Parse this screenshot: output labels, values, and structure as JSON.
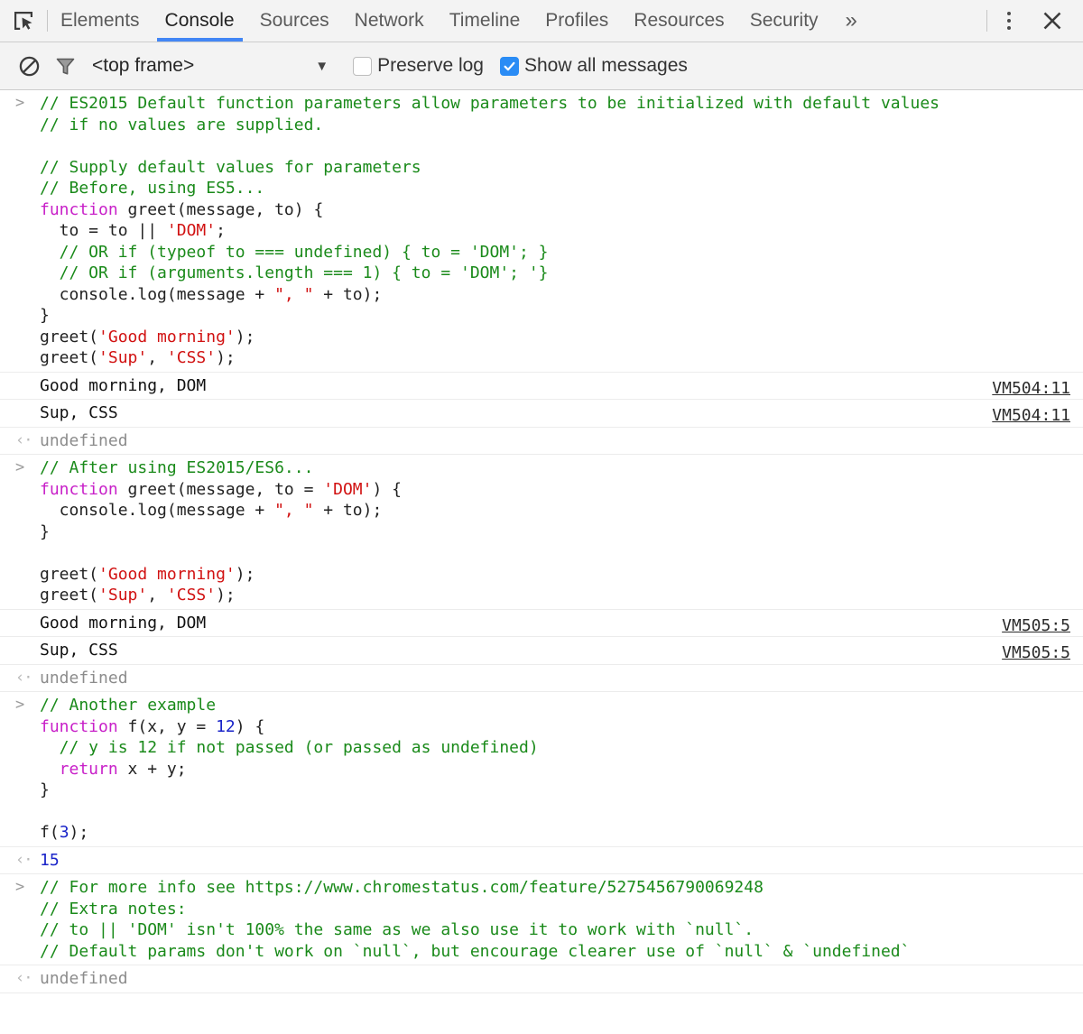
{
  "window": {
    "title": "Chrome DevTools — Console"
  },
  "tabbar": {
    "inspect_icon": "inspect-element-icon",
    "tabs": [
      {
        "label": "Elements",
        "active": false
      },
      {
        "label": "Console",
        "active": true
      },
      {
        "label": "Sources",
        "active": false
      },
      {
        "label": "Network",
        "active": false
      },
      {
        "label": "Timeline",
        "active": false
      },
      {
        "label": "Profiles",
        "active": false
      },
      {
        "label": "Resources",
        "active": false
      },
      {
        "label": "Security",
        "active": false
      }
    ],
    "overflow_label": "»",
    "menu_icon": "kebab-menu-icon",
    "close_label": "✕",
    "active_tab_accent": "#4286f5"
  },
  "toolbar": {
    "clear_icon": "clear-console-icon",
    "filter_icon": "filter-funnel-icon",
    "frame_value": "<top frame>",
    "frame_caret": "▼",
    "preserve_log": {
      "label": "Preserve log",
      "checked": false
    },
    "show_all_messages": {
      "label": "Show all messages",
      "checked": true,
      "accent": "#2a8cf5"
    }
  },
  "console": {
    "prompt_glyph": ">",
    "result_glyph": "‹·",
    "messages": [
      {
        "kind": "input",
        "tokens": [
          [
            [
              "com",
              "// ES2015 Default function parameters allow parameters to be initialized with default values"
            ]
          ],
          [
            [
              "com",
              "// if no values are supplied."
            ]
          ],
          [
            [
              "pln",
              ""
            ]
          ],
          [
            [
              "com",
              "// Supply default values for parameters"
            ]
          ],
          [
            [
              "com",
              "// Before, using ES5..."
            ]
          ],
          [
            [
              "kw",
              "function"
            ],
            [
              "pln",
              " greet(message, to) {"
            ]
          ],
          [
            [
              "pln",
              "  to = to || "
            ],
            [
              "str",
              "'DOM'"
            ],
            [
              "pln",
              ";"
            ]
          ],
          [
            [
              "com",
              "  // OR if (typeof to === undefined) { to = 'DOM'; }"
            ]
          ],
          [
            [
              "com",
              "  // OR if (arguments.length === 1) { to = 'DOM'; '}"
            ]
          ],
          [
            [
              "pln",
              "  console.log(message + "
            ],
            [
              "str",
              "\", \""
            ],
            [
              "pln",
              " + to);"
            ]
          ],
          [
            [
              "pln",
              "}"
            ]
          ],
          [
            [
              "pln",
              "greet("
            ],
            [
              "str",
              "'Good morning'"
            ],
            [
              "pln",
              ");"
            ]
          ],
          [
            [
              "pln",
              "greet("
            ],
            [
              "str",
              "'Sup'"
            ],
            [
              "pln",
              ", "
            ],
            [
              "str",
              "'CSS'"
            ],
            [
              "pln",
              ");"
            ]
          ]
        ]
      },
      {
        "kind": "output",
        "text": "Good morning, DOM",
        "link": "VM504:11"
      },
      {
        "kind": "output",
        "text": "Sup, CSS",
        "link": "VM504:11"
      },
      {
        "kind": "result",
        "text": "undefined"
      },
      {
        "kind": "input",
        "tokens": [
          [
            [
              "com",
              "// After using ES2015/ES6..."
            ]
          ],
          [
            [
              "kw",
              "function"
            ],
            [
              "pln",
              " greet(message, to = "
            ],
            [
              "str",
              "'DOM'"
            ],
            [
              "pln",
              ") {"
            ]
          ],
          [
            [
              "pln",
              "  console.log(message + "
            ],
            [
              "str",
              "\", \""
            ],
            [
              "pln",
              " + to);"
            ]
          ],
          [
            [
              "pln",
              "}"
            ]
          ],
          [
            [
              "pln",
              ""
            ]
          ],
          [
            [
              "pln",
              "greet("
            ],
            [
              "str",
              "'Good morning'"
            ],
            [
              "pln",
              ");"
            ]
          ],
          [
            [
              "pln",
              "greet("
            ],
            [
              "str",
              "'Sup'"
            ],
            [
              "pln",
              ", "
            ],
            [
              "str",
              "'CSS'"
            ],
            [
              "pln",
              ");"
            ]
          ]
        ]
      },
      {
        "kind": "output",
        "text": "Good morning, DOM",
        "link": "VM505:5"
      },
      {
        "kind": "output",
        "text": "Sup, CSS",
        "link": "VM505:5"
      },
      {
        "kind": "result",
        "text": "undefined"
      },
      {
        "kind": "input",
        "tokens": [
          [
            [
              "com",
              "// Another example"
            ]
          ],
          [
            [
              "kw",
              "function"
            ],
            [
              "pln",
              " f(x, y = "
            ],
            [
              "num",
              "12"
            ],
            [
              "pln",
              ") {"
            ]
          ],
          [
            [
              "com",
              "  // y is 12 if not passed (or passed as undefined)"
            ]
          ],
          [
            [
              "kw",
              "  return"
            ],
            [
              "pln",
              " x + y;"
            ]
          ],
          [
            [
              "pln",
              "}"
            ]
          ],
          [
            [
              "pln",
              ""
            ]
          ],
          [
            [
              "pln",
              "f("
            ],
            [
              "num",
              "3"
            ],
            [
              "pln",
              ");"
            ]
          ]
        ]
      },
      {
        "kind": "result-num",
        "text": "15"
      },
      {
        "kind": "input",
        "tokens": [
          [
            [
              "com",
              "// For more info see https://www.chromestatus.com/feature/5275456790069248"
            ]
          ],
          [
            [
              "com",
              "// Extra notes:"
            ]
          ],
          [
            [
              "com",
              "// to || 'DOM' isn't 100% the same as we also use it to work with `null`."
            ]
          ],
          [
            [
              "com",
              "// Default params don't work on `null`, but encourage clearer use of `null` & `undefined`"
            ]
          ]
        ]
      },
      {
        "kind": "result",
        "text": "undefined"
      }
    ]
  }
}
